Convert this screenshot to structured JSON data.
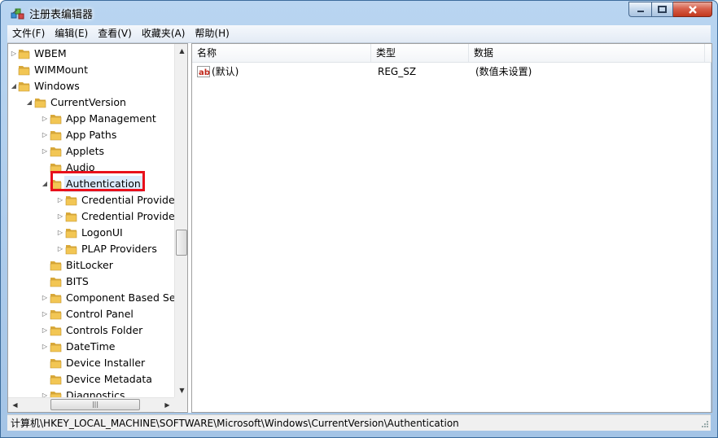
{
  "window": {
    "title": "注册表编辑器"
  },
  "menu": [
    "文件(F)",
    "编辑(E)",
    "查看(V)",
    "收藏夹(A)",
    "帮助(H)"
  ],
  "tree": {
    "items": [
      {
        "label": "WBEM",
        "level": 0,
        "expander": "collapsed"
      },
      {
        "label": "WIMMount",
        "level": 0,
        "expander": "none"
      },
      {
        "label": "Windows",
        "level": 0,
        "expander": "expanded"
      },
      {
        "label": "CurrentVersion",
        "level": 1,
        "expander": "expanded"
      },
      {
        "label": "App Management",
        "level": 2,
        "expander": "collapsed"
      },
      {
        "label": "App Paths",
        "level": 2,
        "expander": "collapsed"
      },
      {
        "label": "Applets",
        "level": 2,
        "expander": "collapsed"
      },
      {
        "label": "Audio",
        "level": 2,
        "expander": "none"
      },
      {
        "label": "Authentication",
        "level": 2,
        "expander": "expanded",
        "selected": true
      },
      {
        "label": "Credential Providers",
        "level": 3,
        "expander": "collapsed"
      },
      {
        "label": "Credential Provider Filters",
        "level": 3,
        "expander": "collapsed"
      },
      {
        "label": "LogonUI",
        "level": 3,
        "expander": "collapsed"
      },
      {
        "label": "PLAP Providers",
        "level": 3,
        "expander": "collapsed"
      },
      {
        "label": "BitLocker",
        "level": 2,
        "expander": "none"
      },
      {
        "label": "BITS",
        "level": 2,
        "expander": "none"
      },
      {
        "label": "Component Based Servicing",
        "level": 2,
        "expander": "collapsed"
      },
      {
        "label": "Control Panel",
        "level": 2,
        "expander": "collapsed"
      },
      {
        "label": "Controls Folder",
        "level": 2,
        "expander": "collapsed"
      },
      {
        "label": "DateTime",
        "level": 2,
        "expander": "collapsed"
      },
      {
        "label": "Device Installer",
        "level": 2,
        "expander": "none"
      },
      {
        "label": "Device Metadata",
        "level": 2,
        "expander": "none"
      },
      {
        "label": "Diagnostics",
        "level": 2,
        "expander": "collapsed"
      }
    ]
  },
  "list": {
    "columns": {
      "name": "名称",
      "type": "类型",
      "data": "数据"
    },
    "rows": [
      {
        "name": "(默认)",
        "type": "REG_SZ",
        "data": "(数值未设置)"
      }
    ]
  },
  "status": {
    "path": "计算机\\HKEY_LOCAL_MACHINE\\SOFTWARE\\Microsoft\\Windows\\CurrentVersion\\Authentication"
  },
  "colors": {
    "highlight": "#e8101b",
    "folder": "#f2c654",
    "title_bar": "#b9d5f1"
  }
}
